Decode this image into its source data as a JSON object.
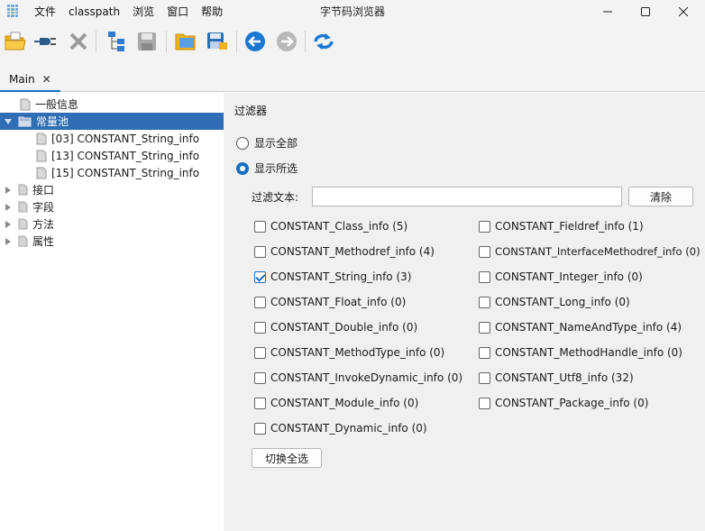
{
  "window": {
    "title": "字节码浏览器",
    "menu": [
      "文件",
      "classpath",
      "浏览",
      "窗口",
      "帮助"
    ]
  },
  "tabs": [
    {
      "label": "Main"
    }
  ],
  "tree": {
    "items": [
      {
        "label": "一般信息",
        "level": 0,
        "type": "leaf"
      },
      {
        "label": "常量池",
        "level": 0,
        "type": "expanded-folder",
        "selected": true
      },
      {
        "label": "[03] CONSTANT_String_info",
        "level": 1,
        "type": "leaf"
      },
      {
        "label": "[13] CONSTANT_String_info",
        "level": 1,
        "type": "leaf"
      },
      {
        "label": "[15] CONSTANT_String_info",
        "level": 1,
        "type": "leaf"
      },
      {
        "label": "接口",
        "level": 0,
        "type": "collapsed"
      },
      {
        "label": "字段",
        "level": 0,
        "type": "collapsed"
      },
      {
        "label": "方法",
        "level": 0,
        "type": "collapsed"
      },
      {
        "label": "属性",
        "level": 0,
        "type": "collapsed"
      }
    ]
  },
  "filter": {
    "title": "过滤器",
    "show_all": "显示全部",
    "show_selected": "显示所选",
    "selected_mode": "show_selected",
    "text_label": "过滤文本:",
    "text_value": "",
    "clear_button": "清除",
    "toggle_button": "切换全选",
    "left_column": [
      {
        "label": "CONSTANT_Class_info (5)",
        "checked": false
      },
      {
        "label": "CONSTANT_Methodref_info (4)",
        "checked": false
      },
      {
        "label": "CONSTANT_String_info (3)",
        "checked": true
      },
      {
        "label": "CONSTANT_Float_info (0)",
        "checked": false
      },
      {
        "label": "CONSTANT_Double_info (0)",
        "checked": false
      },
      {
        "label": "CONSTANT_MethodType_info (0)",
        "checked": false
      },
      {
        "label": "CONSTANT_InvokeDynamic_info (0)",
        "checked": false
      },
      {
        "label": "CONSTANT_Module_info (0)",
        "checked": false
      },
      {
        "label": "CONSTANT_Dynamic_info (0)",
        "checked": false
      }
    ],
    "right_column": [
      {
        "label": "CONSTANT_Fieldref_info (1)",
        "checked": false
      },
      {
        "label": "CONSTANT_InterfaceMethodref_info (0)",
        "checked": false
      },
      {
        "label": "CONSTANT_Integer_info (0)",
        "checked": false
      },
      {
        "label": "CONSTANT_Long_info (0)",
        "checked": false
      },
      {
        "label": "CONSTANT_NameAndType_info (4)",
        "checked": false
      },
      {
        "label": "CONSTANT_MethodHandle_info (0)",
        "checked": false
      },
      {
        "label": "CONSTANT_Utf8_info (32)",
        "checked": false
      },
      {
        "label": "CONSTANT_Package_info (0)",
        "checked": false
      }
    ]
  },
  "toolbar_icons": [
    "open-folder-icon",
    "plugin-icon",
    "close-x-icon",
    "tree-structure-icon",
    "save-icon",
    "folder-open-icon",
    "save-as-icon",
    "back-arrow-icon",
    "forward-arrow-icon",
    "refresh-icon"
  ],
  "colors": {
    "selection": "#2f6db5",
    "accent": "#1a6fbf",
    "panel_bg": "#f0f0f0"
  }
}
